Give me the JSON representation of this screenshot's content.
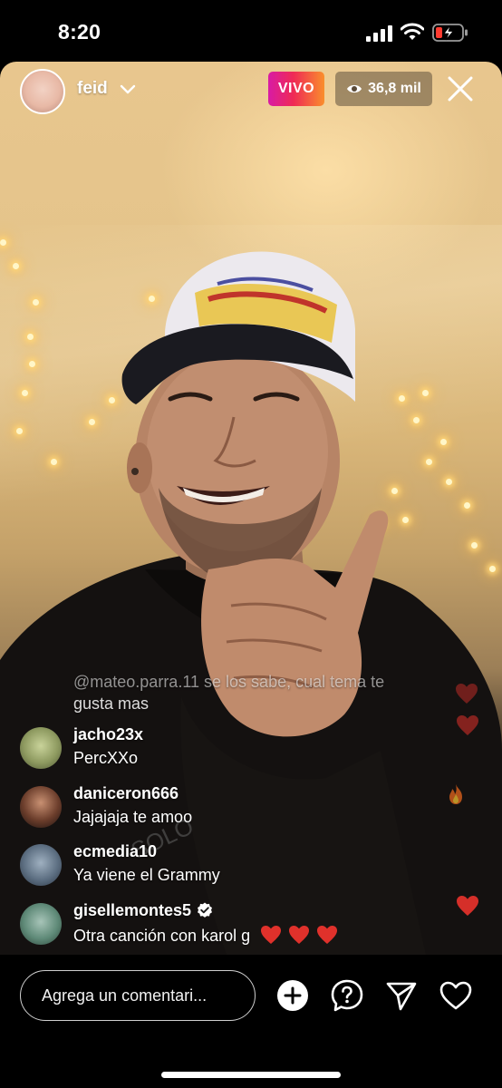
{
  "status_bar": {
    "time": "8:20",
    "icons": [
      "cellular-signal-icon",
      "wifi-icon",
      "battery-low-charging-icon"
    ]
  },
  "live_header": {
    "host_name": "feid",
    "live_label": "VIVO",
    "viewer_count": "36,8 mil",
    "icons": [
      "chevron-down-icon",
      "eye-icon",
      "close-icon"
    ]
  },
  "comments": [
    {
      "user": "@mateo.parra.11",
      "text": "se los sabe, cual tema te",
      "text_line2": "gusta mas",
      "faded": true
    },
    {
      "user": "jacho23x",
      "text": "PercXXo"
    },
    {
      "user": "daniceron666",
      "text": "Jajajaja te amoo"
    },
    {
      "user": "ecmedia10",
      "text": "Ya viene el Grammy"
    },
    {
      "user": "gisellemontes5",
      "text": "Otra canción con karol g",
      "verified": true,
      "emoji": [
        "heart",
        "heart",
        "heart"
      ]
    }
  ],
  "bottom_bar": {
    "comment_placeholder": "Agrega un comentari...",
    "icons": [
      "add-circle-icon",
      "question-icon",
      "send-icon",
      "heart-icon"
    ]
  },
  "colors": {
    "live_gradient": [
      "#d81ba5",
      "#ef2a55",
      "#fa8e2c"
    ],
    "heart": "#e0312b",
    "battery_low": "#ff3b30"
  }
}
